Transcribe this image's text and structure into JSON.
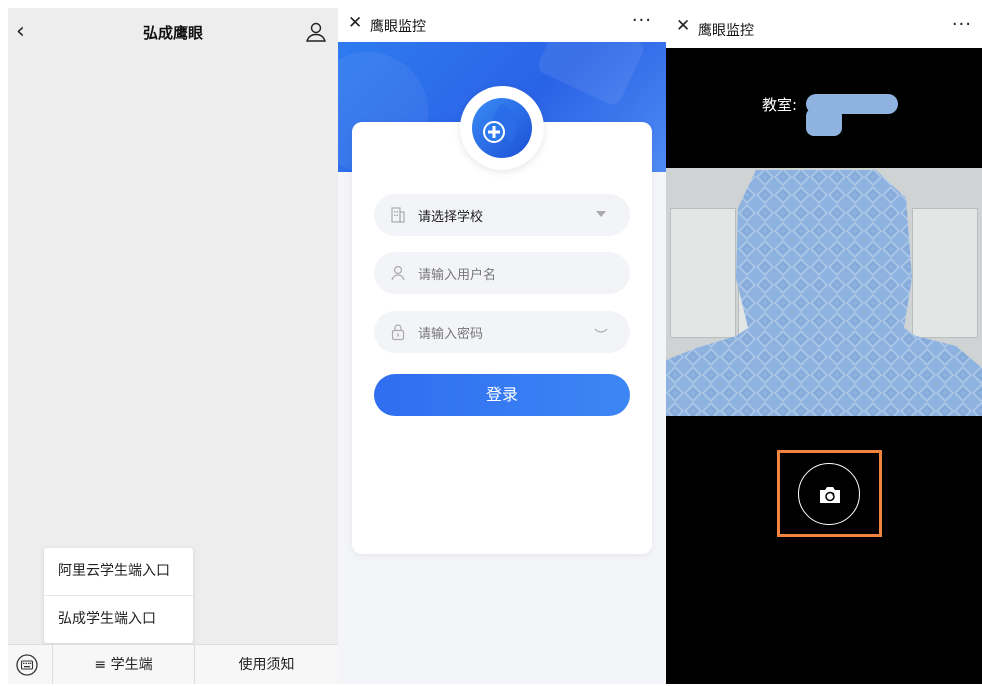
{
  "panel1": {
    "title": "弘成鹰眼",
    "popup_items": [
      "阿里云学生端入口",
      "弘成学生端入口"
    ],
    "bottom_tabs": {
      "student": "≡ 学生端",
      "notice": "使用须知"
    }
  },
  "panel2": {
    "title": "鹰眼监控",
    "more": "···",
    "school_select": "请选择学校",
    "username_placeholder": "请输入用户名",
    "password_placeholder": "请输入密码",
    "login_label": "登录",
    "colors": {
      "primary": "#2f6ef0"
    }
  },
  "panel3": {
    "title": "鹰眼监控",
    "more": "···",
    "classroom_label": "教室:",
    "colors": {
      "highlight": "#f0833f",
      "redaction": "#8fb3e0"
    }
  }
}
